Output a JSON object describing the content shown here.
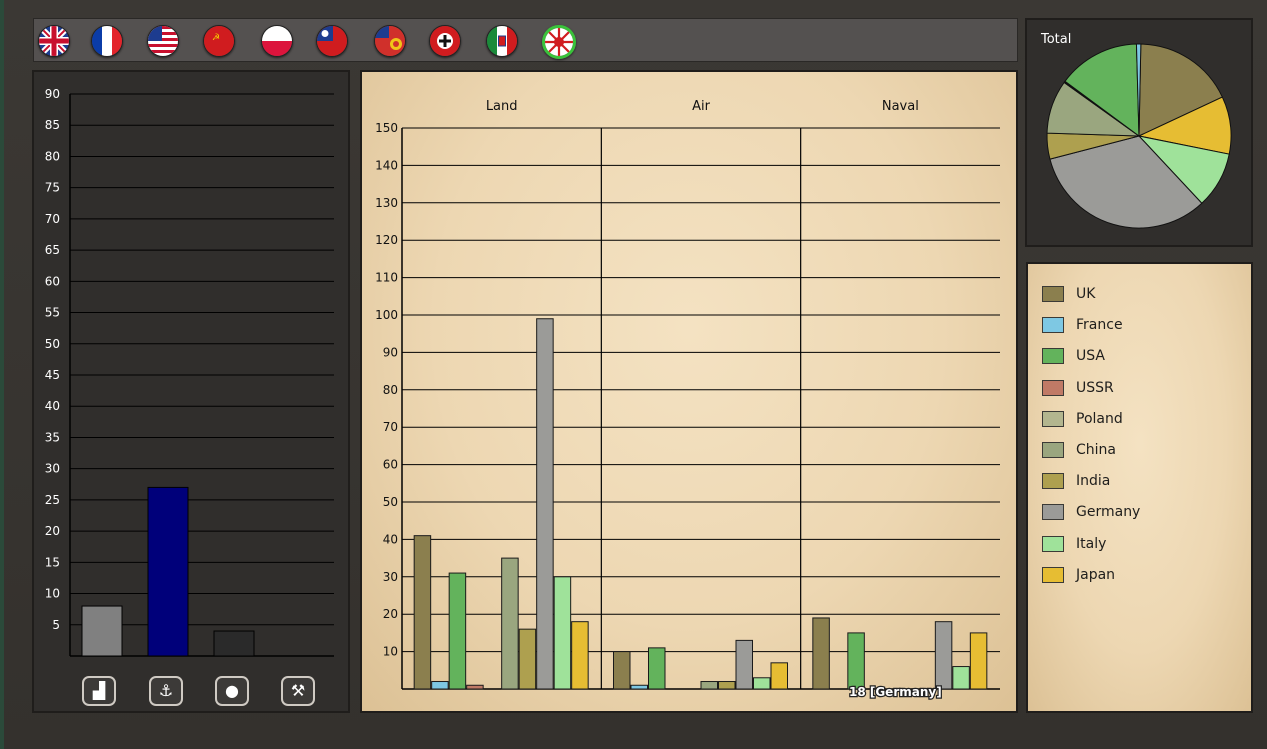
{
  "flags": [
    {
      "name": "flag-uk-icon"
    },
    {
      "name": "flag-france-icon"
    },
    {
      "name": "flag-usa-icon"
    },
    {
      "name": "flag-ussr-icon"
    },
    {
      "name": "flag-poland-icon"
    },
    {
      "name": "flag-china-icon"
    },
    {
      "name": "flag-india-icon"
    },
    {
      "name": "flag-germany-icon"
    },
    {
      "name": "flag-italy-icon"
    },
    {
      "name": "flag-japan-icon"
    }
  ],
  "resource_chart": {
    "type": "bar",
    "ylim": [
      0,
      90
    ],
    "yticks": [
      "5",
      "10",
      "15",
      "20",
      "25",
      "30",
      "35",
      "40",
      "45",
      "50",
      "55",
      "60",
      "65",
      "70",
      "75",
      "80",
      "85",
      "90"
    ],
    "values": [
      8,
      27,
      4,
      0
    ],
    "colors": [
      "#808080",
      "#00007a",
      "#2a2a2a",
      "#2a2a2a"
    ],
    "buttons": [
      {
        "name": "factory-icon",
        "glyph": "▟"
      },
      {
        "name": "anchor-icon",
        "glyph": "⚓"
      },
      {
        "name": "oil-drop-icon",
        "glyph": "●"
      },
      {
        "name": "hammer-pick-icon",
        "glyph": "⚒"
      }
    ]
  },
  "chart_data": [
    {
      "type": "bar",
      "categories": [
        "Land",
        "Air",
        "Naval"
      ],
      "ylim": [
        0,
        150
      ],
      "yticks": [
        "10",
        "20",
        "30",
        "40",
        "50",
        "60",
        "70",
        "80",
        "90",
        "100",
        "110",
        "120",
        "130",
        "140",
        "150"
      ],
      "series": [
        {
          "name": "UK",
          "color": "#8b7f4e",
          "values": [
            41,
            10,
            19
          ]
        },
        {
          "name": "France",
          "color": "#7ec8e3",
          "values": [
            2,
            1,
            0
          ]
        },
        {
          "name": "USA",
          "color": "#63b35c",
          "values": [
            31,
            11,
            15
          ]
        },
        {
          "name": "USSR",
          "color": "#c07a66",
          "values": [
            1,
            0,
            0
          ]
        },
        {
          "name": "Poland",
          "color": "#b3b68f",
          "values": [
            0,
            0,
            0
          ]
        },
        {
          "name": "China",
          "color": "#9aa67f",
          "values": [
            35,
            2,
            0
          ]
        },
        {
          "name": "India",
          "color": "#aea04f",
          "values": [
            16,
            2,
            0
          ]
        },
        {
          "name": "Germany",
          "color": "#9b9b98",
          "values": [
            99,
            13,
            18
          ]
        },
        {
          "name": "Italy",
          "color": "#9fe29a",
          "values": [
            30,
            3,
            6
          ]
        },
        {
          "name": "Japan",
          "color": "#e6bd33",
          "values": [
            18,
            7,
            15
          ]
        }
      ],
      "annotation": "18 [Germany]"
    },
    {
      "type": "pie",
      "title": "Total",
      "slices": [
        {
          "name": "UK",
          "color": "#8b7f4e",
          "value": 70
        },
        {
          "name": "Japan",
          "color": "#e6bd33",
          "value": 40
        },
        {
          "name": "Italy",
          "color": "#9fe29a",
          "value": 39
        },
        {
          "name": "Germany",
          "color": "#9b9b98",
          "value": 130
        },
        {
          "name": "India",
          "color": "#aea04f",
          "value": 18
        },
        {
          "name": "China",
          "color": "#9aa67f",
          "value": 37
        },
        {
          "name": "Poland",
          "color": "#b3b68f",
          "value": 0.5
        },
        {
          "name": "USSR",
          "color": "#c07a66",
          "value": 0.5
        },
        {
          "name": "USA",
          "color": "#63b35c",
          "value": 57
        },
        {
          "name": "France",
          "color": "#7ec8e3",
          "value": 3
        }
      ]
    }
  ],
  "legend": [
    {
      "label": "UK",
      "color": "#8b7f4e"
    },
    {
      "label": "France",
      "color": "#7ec8e3"
    },
    {
      "label": "USA",
      "color": "#63b35c"
    },
    {
      "label": "USSR",
      "color": "#c07a66"
    },
    {
      "label": "Poland",
      "color": "#b3b68f"
    },
    {
      "label": "China",
      "color": "#9aa67f"
    },
    {
      "label": "India",
      "color": "#aea04f"
    },
    {
      "label": "Germany",
      "color": "#9b9b98"
    },
    {
      "label": "Italy",
      "color": "#9fe29a"
    },
    {
      "label": "Japan",
      "color": "#e6bd33"
    }
  ]
}
